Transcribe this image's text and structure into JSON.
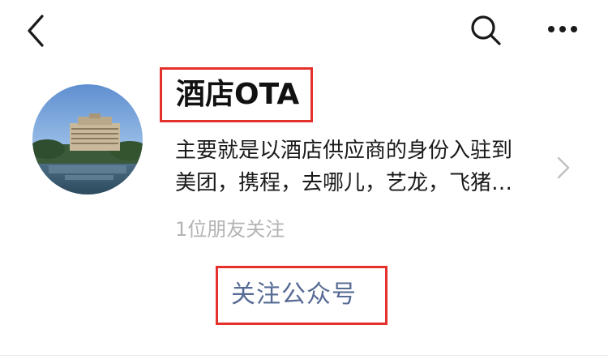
{
  "nav": {
    "back_icon": "chevron-left-icon",
    "search_icon": "search-icon",
    "more_icon": "more-horizontal-icon"
  },
  "account": {
    "name": "酒店OTA",
    "description_line1": "主要就是以酒店供应商的身份入驻到",
    "description_line2": "美团，携程，去哪儿，艺龙，飞猪…",
    "followers": "1位朋友关注",
    "follow_label": "关注公众号"
  },
  "colors": {
    "highlight_border": "#e5312b",
    "link": "#576b95",
    "muted": "#b3b3b3"
  }
}
